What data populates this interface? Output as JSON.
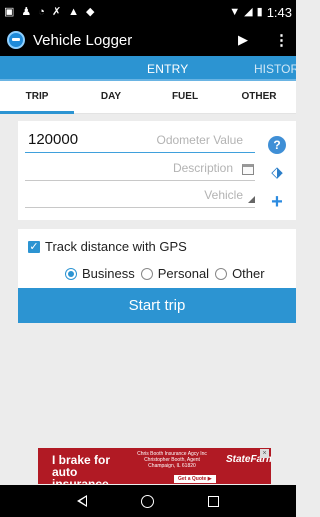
{
  "status_bar": {
    "time": "1:43"
  },
  "app": {
    "title": "Vehicle Logger"
  },
  "tabs": {
    "entry": "ENTRY",
    "history": "HISTOR"
  },
  "subtabs": [
    "TRIP",
    "DAY",
    "FUEL",
    "OTHER"
  ],
  "form": {
    "odometer_value": "120000",
    "odometer_placeholder": "Odometer Value",
    "description_placeholder": "Description",
    "vehicle_placeholder": "Vehicle"
  },
  "gps": {
    "track_label": "Track distance with GPS",
    "track_checked": true,
    "options": [
      "Business",
      "Personal",
      "Other"
    ],
    "selected": "Business",
    "start_button": "Start trip"
  },
  "ad": {
    "headline": "I brake for auto insurance.",
    "agent_lines": [
      "Chris Booth Insurance Agcy Inc",
      "Christopher Booth, Agent",
      "Champaign, IL 61820"
    ],
    "cta": "Get a Quote ▶",
    "brand": "StateFarm"
  },
  "colors": {
    "accent": "#2c94d2",
    "appbar": "#000000",
    "ad_bg": "#b11a24"
  }
}
